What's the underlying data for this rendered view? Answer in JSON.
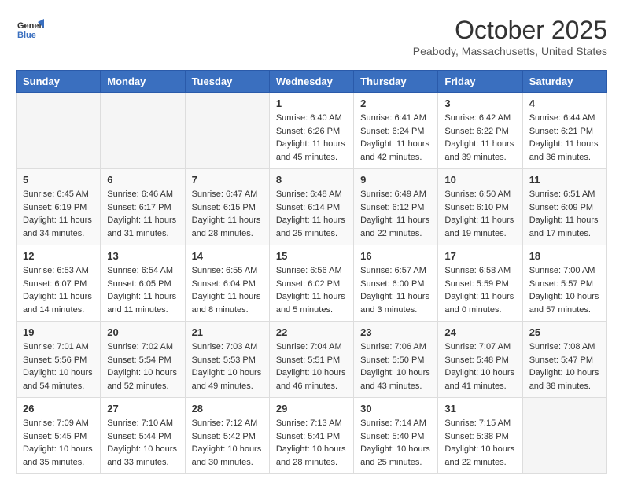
{
  "header": {
    "logo_general": "General",
    "logo_blue": "Blue",
    "month": "October 2025",
    "location": "Peabody, Massachusetts, United States"
  },
  "days_of_week": [
    "Sunday",
    "Monday",
    "Tuesday",
    "Wednesday",
    "Thursday",
    "Friday",
    "Saturday"
  ],
  "weeks": [
    [
      {
        "day": "",
        "info": ""
      },
      {
        "day": "",
        "info": ""
      },
      {
        "day": "",
        "info": ""
      },
      {
        "day": "1",
        "info": "Sunrise: 6:40 AM\nSunset: 6:26 PM\nDaylight: 11 hours\nand 45 minutes."
      },
      {
        "day": "2",
        "info": "Sunrise: 6:41 AM\nSunset: 6:24 PM\nDaylight: 11 hours\nand 42 minutes."
      },
      {
        "day": "3",
        "info": "Sunrise: 6:42 AM\nSunset: 6:22 PM\nDaylight: 11 hours\nand 39 minutes."
      },
      {
        "day": "4",
        "info": "Sunrise: 6:44 AM\nSunset: 6:21 PM\nDaylight: 11 hours\nand 36 minutes."
      }
    ],
    [
      {
        "day": "5",
        "info": "Sunrise: 6:45 AM\nSunset: 6:19 PM\nDaylight: 11 hours\nand 34 minutes."
      },
      {
        "day": "6",
        "info": "Sunrise: 6:46 AM\nSunset: 6:17 PM\nDaylight: 11 hours\nand 31 minutes."
      },
      {
        "day": "7",
        "info": "Sunrise: 6:47 AM\nSunset: 6:15 PM\nDaylight: 11 hours\nand 28 minutes."
      },
      {
        "day": "8",
        "info": "Sunrise: 6:48 AM\nSunset: 6:14 PM\nDaylight: 11 hours\nand 25 minutes."
      },
      {
        "day": "9",
        "info": "Sunrise: 6:49 AM\nSunset: 6:12 PM\nDaylight: 11 hours\nand 22 minutes."
      },
      {
        "day": "10",
        "info": "Sunrise: 6:50 AM\nSunset: 6:10 PM\nDaylight: 11 hours\nand 19 minutes."
      },
      {
        "day": "11",
        "info": "Sunrise: 6:51 AM\nSunset: 6:09 PM\nDaylight: 11 hours\nand 17 minutes."
      }
    ],
    [
      {
        "day": "12",
        "info": "Sunrise: 6:53 AM\nSunset: 6:07 PM\nDaylight: 11 hours\nand 14 minutes."
      },
      {
        "day": "13",
        "info": "Sunrise: 6:54 AM\nSunset: 6:05 PM\nDaylight: 11 hours\nand 11 minutes."
      },
      {
        "day": "14",
        "info": "Sunrise: 6:55 AM\nSunset: 6:04 PM\nDaylight: 11 hours\nand 8 minutes."
      },
      {
        "day": "15",
        "info": "Sunrise: 6:56 AM\nSunset: 6:02 PM\nDaylight: 11 hours\nand 5 minutes."
      },
      {
        "day": "16",
        "info": "Sunrise: 6:57 AM\nSunset: 6:00 PM\nDaylight: 11 hours\nand 3 minutes."
      },
      {
        "day": "17",
        "info": "Sunrise: 6:58 AM\nSunset: 5:59 PM\nDaylight: 11 hours\nand 0 minutes."
      },
      {
        "day": "18",
        "info": "Sunrise: 7:00 AM\nSunset: 5:57 PM\nDaylight: 10 hours\nand 57 minutes."
      }
    ],
    [
      {
        "day": "19",
        "info": "Sunrise: 7:01 AM\nSunset: 5:56 PM\nDaylight: 10 hours\nand 54 minutes."
      },
      {
        "day": "20",
        "info": "Sunrise: 7:02 AM\nSunset: 5:54 PM\nDaylight: 10 hours\nand 52 minutes."
      },
      {
        "day": "21",
        "info": "Sunrise: 7:03 AM\nSunset: 5:53 PM\nDaylight: 10 hours\nand 49 minutes."
      },
      {
        "day": "22",
        "info": "Sunrise: 7:04 AM\nSunset: 5:51 PM\nDaylight: 10 hours\nand 46 minutes."
      },
      {
        "day": "23",
        "info": "Sunrise: 7:06 AM\nSunset: 5:50 PM\nDaylight: 10 hours\nand 43 minutes."
      },
      {
        "day": "24",
        "info": "Sunrise: 7:07 AM\nSunset: 5:48 PM\nDaylight: 10 hours\nand 41 minutes."
      },
      {
        "day": "25",
        "info": "Sunrise: 7:08 AM\nSunset: 5:47 PM\nDaylight: 10 hours\nand 38 minutes."
      }
    ],
    [
      {
        "day": "26",
        "info": "Sunrise: 7:09 AM\nSunset: 5:45 PM\nDaylight: 10 hours\nand 35 minutes."
      },
      {
        "day": "27",
        "info": "Sunrise: 7:10 AM\nSunset: 5:44 PM\nDaylight: 10 hours\nand 33 minutes."
      },
      {
        "day": "28",
        "info": "Sunrise: 7:12 AM\nSunset: 5:42 PM\nDaylight: 10 hours\nand 30 minutes."
      },
      {
        "day": "29",
        "info": "Sunrise: 7:13 AM\nSunset: 5:41 PM\nDaylight: 10 hours\nand 28 minutes."
      },
      {
        "day": "30",
        "info": "Sunrise: 7:14 AM\nSunset: 5:40 PM\nDaylight: 10 hours\nand 25 minutes."
      },
      {
        "day": "31",
        "info": "Sunrise: 7:15 AM\nSunset: 5:38 PM\nDaylight: 10 hours\nand 22 minutes."
      },
      {
        "day": "",
        "info": ""
      }
    ]
  ]
}
